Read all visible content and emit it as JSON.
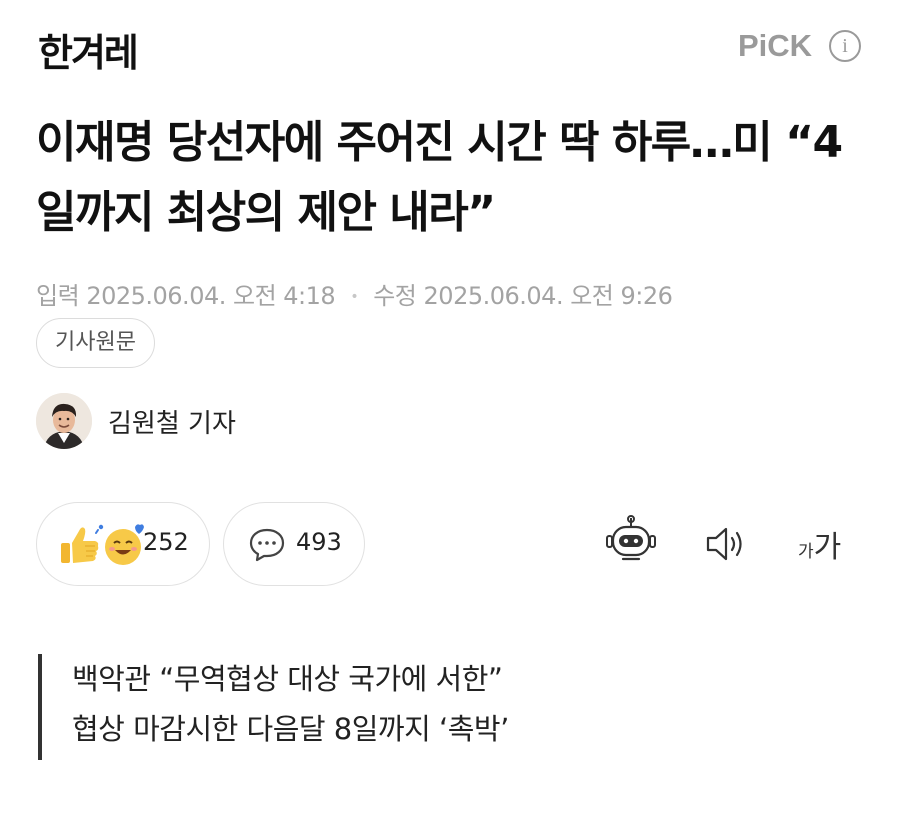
{
  "header": {
    "logo": "한겨레",
    "pick_label": "PiCK",
    "info_icon": "info-icon"
  },
  "article": {
    "headline": "이재명 당선자에 주어진 시간 딱 하루…미 “4일까지 최상의 제안 내라”",
    "meta": {
      "input_label": "입력",
      "input_datetime": "2025.06.04. 오전 4:18",
      "separator": "•",
      "modified_label": "수정",
      "modified_datetime": "2025.06.04. 오전 9:26"
    },
    "source_button": "기사원문",
    "reporter": {
      "name": "김원철 기자",
      "avatar_icon": "reporter-avatar"
    },
    "reactions": {
      "icons": [
        "thumbs-up-icon",
        "smiling-face-icon"
      ],
      "count": "252"
    },
    "comments": {
      "icon": "speech-bubble-icon",
      "count": "493"
    },
    "tools": {
      "summary_bot_icon": "robot-icon",
      "audio_icon": "speaker-icon",
      "font_size_small": "가",
      "font_size_big": "가"
    },
    "summary_lines": [
      "백악관 “무역협상 대상 국가에 서한”",
      "협상 마감시한 다음달 8일까지 ‘촉박’"
    ]
  },
  "colors": {
    "text": "#111111",
    "muted": "#a3a3a3",
    "pick": "#9a9a9a",
    "border": "#e1e1e1",
    "emoji_yellow": "#f7c948",
    "emoji_blue": "#3f7de0"
  }
}
